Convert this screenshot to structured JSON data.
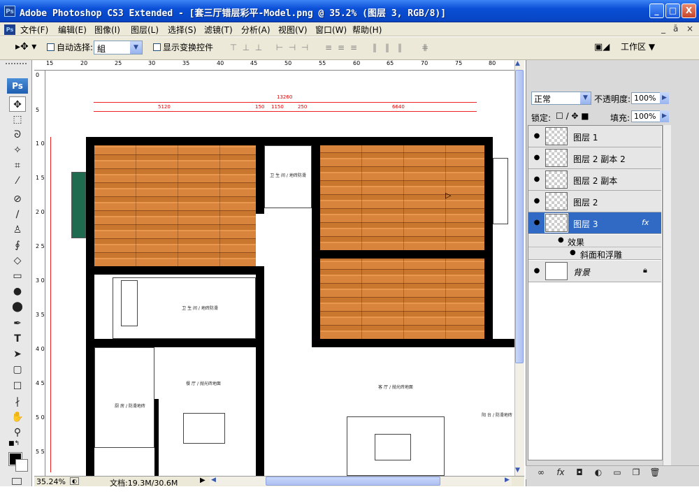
{
  "window": {
    "app_icon": "Ps",
    "title": "Adobe Photoshop CS3 Extended - [套三厅错层彩平-Model.png @ 35.2% (图层 3, RGB/8)]",
    "minimize": "_",
    "maximize": "□",
    "close": "X"
  },
  "menu": {
    "doc_icon": "Ps",
    "items": [
      "文件(F)",
      "编辑(E)",
      "图像(I)",
      "图层(L)",
      "选择(S)",
      "滤镜(T)",
      "分析(A)",
      "视图(V)",
      "窗口(W)",
      "帮助(H)"
    ],
    "doc_controls": [
      "_",
      "ā",
      "×"
    ]
  },
  "options": {
    "auto_select_label": "自动选择:",
    "auto_select_value": "組",
    "show_transform_label": "显示变换控件",
    "workspace_label": "工作区 ▼"
  },
  "toolbox": {
    "logo": "Ps",
    "tools": [
      "move-icon",
      "marquee-icon",
      "lasso-icon",
      "magic-wand-icon",
      "crop-icon",
      "eyedropper-icon",
      "healing-icon",
      "brush-icon",
      "stamp-icon",
      "history-brush-icon",
      "eraser-icon",
      "gradient-icon",
      "blur-icon",
      "dodge-icon",
      "pen-icon",
      "type-icon",
      "path-select-icon",
      "shape-icon",
      "notes-icon",
      "eyedropper2-icon",
      "hand-icon",
      "zoom-icon"
    ],
    "type_glyph": "T"
  },
  "ruler": {
    "h_marks": [
      "15",
      "20",
      "25",
      "30",
      "35",
      "40",
      "45",
      "50",
      "55",
      "60",
      "65",
      "70",
      "75",
      "80"
    ],
    "v_marks": [
      "0",
      "5",
      "1 0",
      "1 5",
      "2 0",
      "2 5",
      "3 0",
      "3 5",
      "4 0",
      "4 5",
      "5 0",
      "5 5"
    ]
  },
  "plan": {
    "dimensions": [
      "13260",
      "5120",
      "150",
      "1150",
      "250",
      "6640"
    ],
    "rooms": [
      "卫 生 间 / 地砖防滑",
      "卫 生 间 / 地砖防滑",
      "餐 厅 / 抛光砖地面",
      "厨 房 / 防滑地砖",
      "客 厅 / 抛光砖地面",
      "阳 台 / 防滑地砖"
    ]
  },
  "status": {
    "zoom": "35.24%",
    "doc_info": "文档:19.3M/30.6M"
  },
  "layers_panel": {
    "blend_mode": "正常",
    "opacity_label": "不透明度:",
    "opacity_value": "100%",
    "lock_label": "锁定:",
    "fill_label": "填充:",
    "fill_value": "100%",
    "layers": [
      {
        "name": "图层 1",
        "selected": false
      },
      {
        "name": "图层 2 副本 2",
        "selected": false
      },
      {
        "name": "图层 2 副本",
        "selected": false
      },
      {
        "name": "图层 2",
        "selected": false
      },
      {
        "name": "图层 3",
        "selected": true,
        "fx": "fx"
      }
    ],
    "effects_label": "效果",
    "effect_item": "斜面和浮雕",
    "background_name": "背景",
    "bottom_icons": [
      "link-icon",
      "fx-icon",
      "mask-icon",
      "adjustment-icon",
      "group-icon",
      "new-layer-icon",
      "trash-icon"
    ]
  },
  "colors": {
    "title_bar": "#0a4fd6",
    "selected_layer": "#316ac5",
    "wood": "#d9843d",
    "dimension_red": "#dd0000"
  }
}
